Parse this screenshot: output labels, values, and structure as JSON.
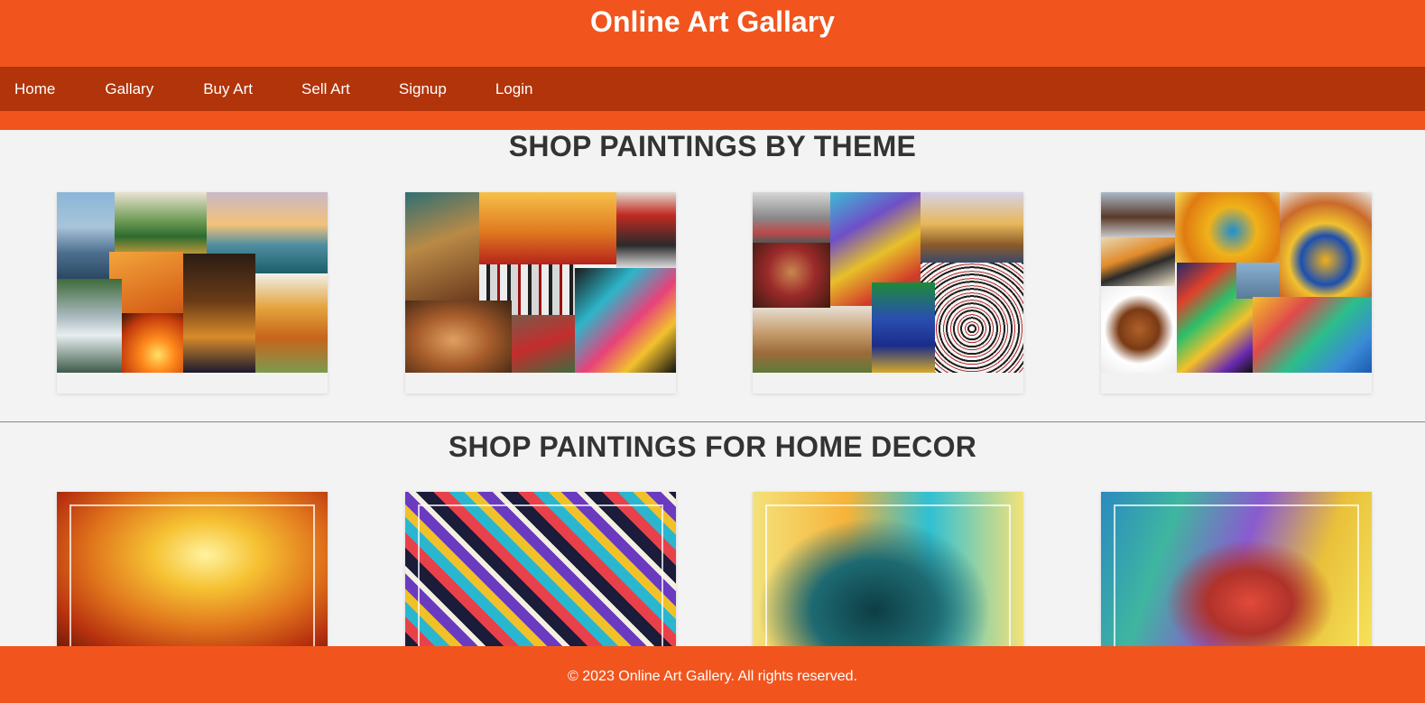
{
  "header": {
    "title": "Online Art Gallary"
  },
  "nav": {
    "items": [
      {
        "label": "Home"
      },
      {
        "label": "Gallary"
      },
      {
        "label": "Buy Art"
      },
      {
        "label": "Sell Art"
      },
      {
        "label": "Signup"
      },
      {
        "label": "Login"
      }
    ]
  },
  "sections": {
    "theme_heading": "SHOP PAINTINGS BY THEME",
    "decor_heading": "SHOP PAINTINGS FOR HOME DECOR"
  },
  "footer": {
    "text": "© 2023 Online Art Gallery. All rights reserved."
  },
  "colors": {
    "brand_orange": "#f1551d",
    "nav_dark_orange": "#b1340a",
    "page_background": "#f3f3f3",
    "heading_text": "#333333"
  }
}
